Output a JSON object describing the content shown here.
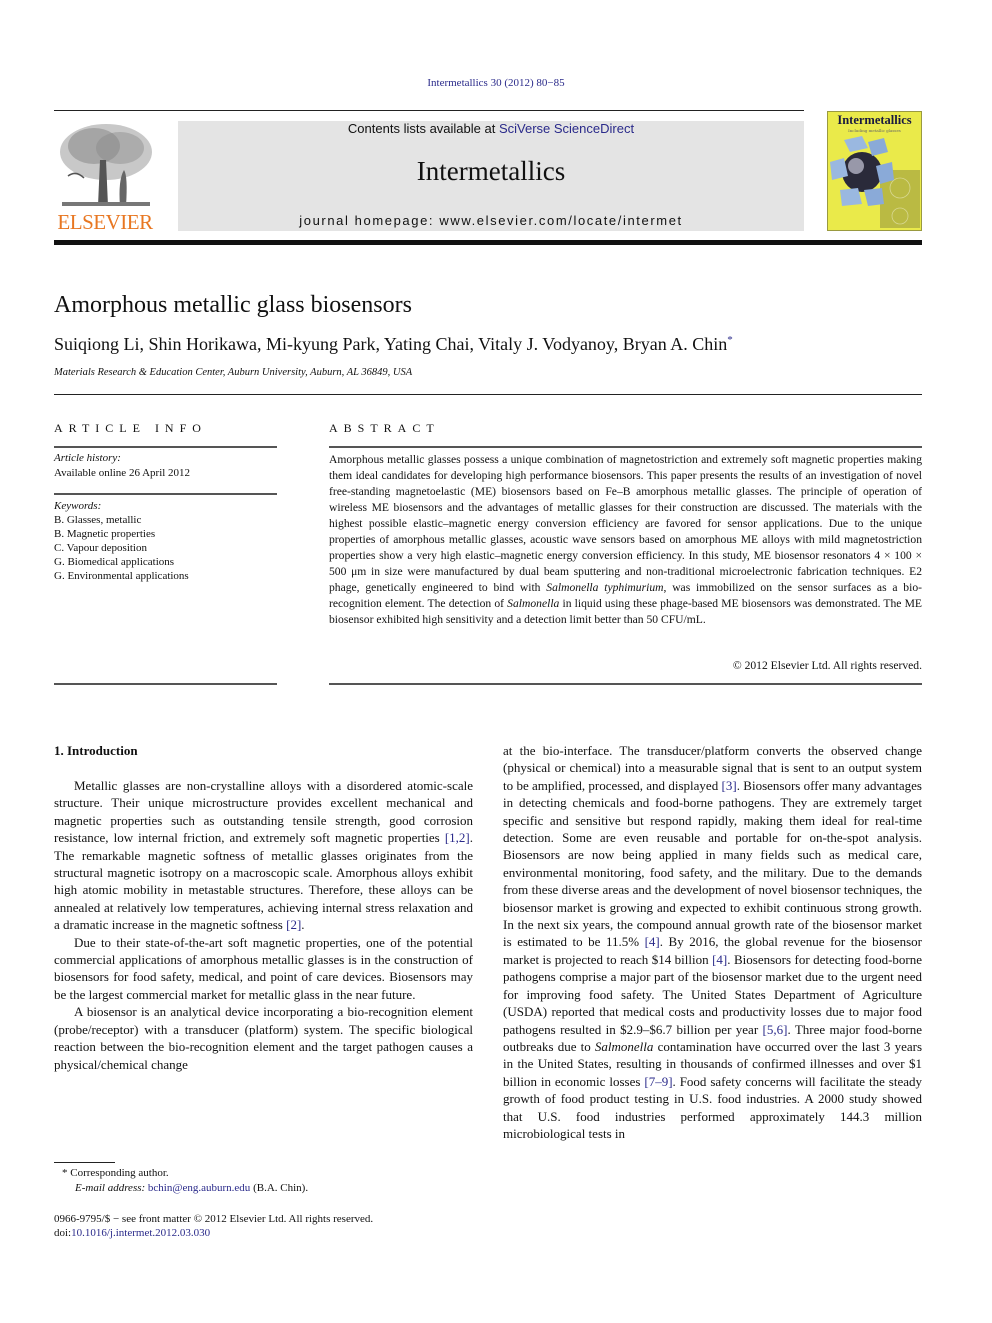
{
  "header": {
    "citation": "Intermetallics 30 (2012) 80−85",
    "contents_prefix": "Contents lists available at ",
    "contents_link": "SciVerse ScienceDirect",
    "journal_name": "Intermetallics",
    "homepage": "journal homepage: www.elsevier.com/locate/intermet",
    "publisher_logo_text": "ELSEVIER",
    "cover_title": "Intermetallics",
    "cover_subtitle": "Including metallic glasses",
    "colors": {
      "publisher_orange": "#e87722",
      "link_blue": "#2a2a8a",
      "masthead_gray": "#e4e4e4",
      "cover_yellow": "#eaea4a"
    }
  },
  "article": {
    "title": "Amorphous metallic glass biosensors",
    "authors": "Suiqiong Li, Shin Horikawa, Mi-kyung Park, Yating Chai, Vitaly J. Vodyanoy, Bryan A. Chin",
    "corresponding_mark": "*",
    "affiliation": "Materials Research & Education Center, Auburn University, Auburn, AL 36849, USA"
  },
  "article_info": {
    "heading": "ARTICLE INFO",
    "history_label": "Article history:",
    "history_value": "Available online 26 April 2012",
    "keywords_label": "Keywords:",
    "keywords": [
      "B. Glasses, metallic",
      "B. Magnetic properties",
      "C. Vapour deposition",
      "G. Biomedical applications",
      "G. Environmental applications"
    ]
  },
  "abstract": {
    "heading": "ABSTRACT",
    "part1": "Amorphous metallic glasses possess a unique combination of magnetostriction and extremely soft magnetic properties making them ideal candidates for developing high performance biosensors. This paper presents the results of an investigation of novel free-standing magnetoelastic (ME) biosensors based on Fe–B amorphous metallic glasses. The principle of operation of wireless ME biosensors and the advantages of metallic glasses for their construction are discussed. The materials with the highest possible elastic–magnetic energy conversion efficiency are favored for sensor applications. Due to the unique properties of amorphous metallic glasses, acoustic wave sensors based on amorphous ME alloys with mild magnetostriction properties show a very high elastic–magnetic energy conversion efficiency. In this study, ME biosensor resonators 4 × 100 × 500 μm in size were manufactured by dual beam sputtering and non-traditional microelectronic fabrication techniques. E2 phage, genetically engineered to bind with ",
    "italic1": "Salmonella typhimurium",
    "part2": ", was immobilized on the sensor surfaces as a bio-recognition element. The detection of ",
    "italic2": "Salmonella",
    "part3": " in liquid using these phage-based ME biosensors was demonstrated. The ME biosensor exhibited high sensitivity and a detection limit better than 50 CFU/mL.",
    "copyright": "© 2012 Elsevier Ltd. All rights reserved."
  },
  "body": {
    "section_heading": "1.  Introduction",
    "left": {
      "p1a": "Metallic glasses are non-crystalline alloys with a disordered atomic-scale structure. Their unique microstructure provides excellent mechanical and magnetic properties such as outstanding tensile strength, good corrosion resistance, low internal friction, and extremely soft magnetic properties ",
      "p1_ref1": "[1,2]",
      "p1b": ". The remarkable magnetic softness of metallic glasses originates from the structural magnetic isotropy on a macroscopic scale. Amorphous alloys exhibit high atomic mobility in metastable structures. Therefore, these alloys can be annealed at relatively low temperatures, achieving internal stress relaxation and a dramatic increase in the magnetic softness ",
      "p1_ref2": "[2]",
      "p1c": ".",
      "p2": "Due to their state-of-the-art soft magnetic properties, one of the potential commercial applications of amorphous metallic glasses is in the construction of biosensors for food safety, medical, and point of care devices. Biosensors may be the largest commercial market for metallic glass in the near future.",
      "p3": "A biosensor is an analytical device incorporating a bio-recognition element (probe/receptor) with a transducer (platform) system. The specific biological reaction between the bio-recognition element and the target pathogen causes a physical/chemical change"
    },
    "right": {
      "a": "at the bio-interface. The transducer/platform converts the observed change (physical or chemical) into a measurable signal that is sent to an output system to be amplified, processed, and displayed ",
      "ref3": "[3]",
      "b": ". Biosensors offer many advantages in detecting chemicals and food-borne pathogens. They are extremely target specific and sensitive but respond rapidly, making them ideal for real-time detection. Some are even reusable and portable for on-the-spot analysis. Biosensors are now being applied in many fields such as medical care, environmental monitoring, food safety, and the military. Due to the demands from these diverse areas and the development of novel biosensor techniques, the biosensor market is growing and expected to exhibit continuous strong growth. In the next six years, the compound annual growth rate of the biosensor market is estimated to be 11.5% ",
      "ref4a": "[4]",
      "c": ". By 2016, the global revenue for the biosensor market is projected to reach $14 billion ",
      "ref4b": "[4]",
      "d": ". Biosensors for detecting food-borne pathogens comprise a major part of the biosensor market due to the urgent need for improving food safety. The United States Department of Agriculture (USDA) reported that medical costs and productivity losses due to major food pathogens resulted in $2.9–$6.7 billion per year ",
      "ref56": "[5,6]",
      "e": ". Three major food-borne outbreaks due to ",
      "italic_salmonella": "Salmonella",
      "f": " contamination have occurred over the last 3 years in the United States, resulting in thousands of confirmed illnesses and over $1 billion in economic losses ",
      "ref79": "[7–9]",
      "g": ". Food safety concerns will facilitate the steady growth of food product testing in U.S. food industries. A 2000 study showed that U.S. food industries performed approximately 144.3 million microbiological tests in"
    }
  },
  "footer": {
    "corresponding": "*  Corresponding author.",
    "email_label": "E-mail address: ",
    "email": "bchin@eng.auburn.edu",
    "email_suffix": " (B.A. Chin).",
    "front_matter": "0966-9795/$ − see front matter © 2012 Elsevier Ltd. All rights reserved.",
    "doi_prefix": "doi:",
    "doi": "10.1016/j.intermet.2012.03.030"
  }
}
